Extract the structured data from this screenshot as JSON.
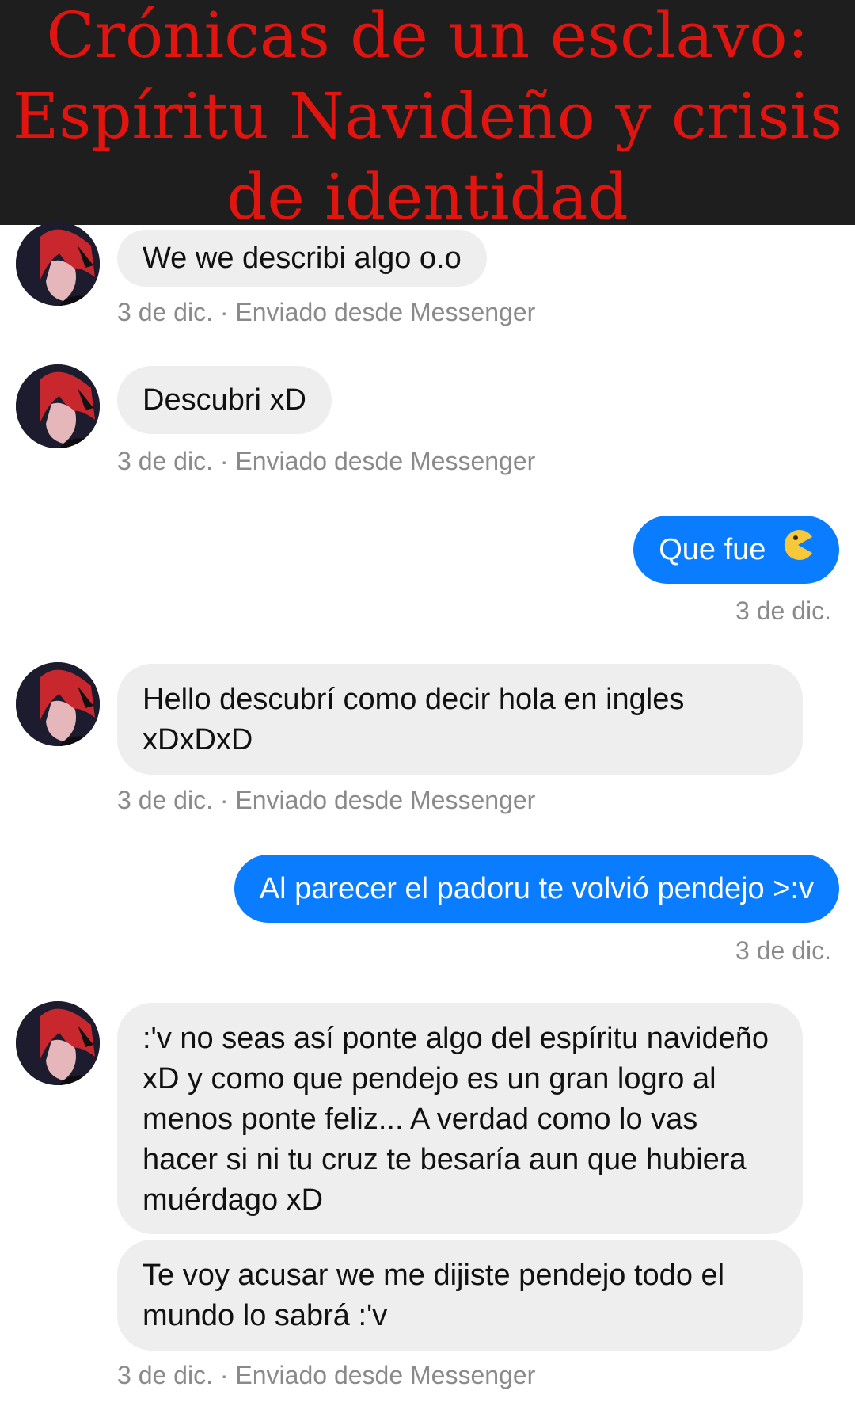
{
  "banner": {
    "title_line1": "Crónicas de un esclavo:",
    "title_line2": "Espíritu Navideño y crisis",
    "title_line3": "de identidad"
  },
  "messages": [
    {
      "from": "them",
      "text": "We we describi algo o.o",
      "meta": "3 de dic. · Enviado desde Messenger"
    },
    {
      "from": "them",
      "text": "Descubri xD",
      "meta": "3 de dic. · Enviado desde Messenger"
    },
    {
      "from": "me",
      "text": "Que fue",
      "emoji": "pacman-face-emoji",
      "meta": "3 de dic."
    },
    {
      "from": "them",
      "text": "Hello descubrí como decir hola en ingles xDxDxD",
      "meta": "3 de dic. · Enviado desde Messenger"
    },
    {
      "from": "me",
      "text": "Al parecer el padoru te volvió pendejo >:v",
      "meta": "3 de dic."
    },
    {
      "from": "them",
      "text": ":'v no seas así ponte algo del espíritu navideño xD y como que pendejo es un gran logro al menos ponte feliz... A verdad como lo vas hacer si ni tu cruz te besaría aun que hubiera muérdago xD"
    },
    {
      "from": "them",
      "text": "Te voy acusar we me dijiste pendejo todo el mundo lo sabrá :'v",
      "meta": "3 de dic. · Enviado desde Messenger"
    }
  ],
  "colors": {
    "banner_bg": "#1e1e1e",
    "banner_text": "#e0150f",
    "incoming_bubble": "#eeeeee",
    "outgoing_bubble": "#0a7cff",
    "meta_text": "#8a8a8a"
  }
}
